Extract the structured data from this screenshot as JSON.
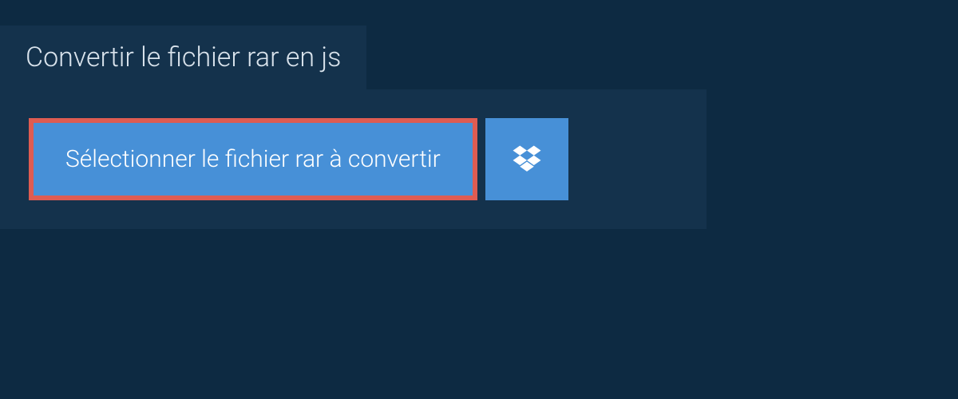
{
  "tab": {
    "title": "Convertir le fichier rar en js"
  },
  "actions": {
    "select_label": "Sélectionner le fichier rar à convertir",
    "dropbox_icon_name": "dropbox"
  },
  "colors": {
    "background": "#0d2a42",
    "panel": "#14324c",
    "button": "#4790d7",
    "highlight_border": "#de5c52",
    "text_light": "#d9e3ec",
    "text_white": "#ffffff"
  }
}
